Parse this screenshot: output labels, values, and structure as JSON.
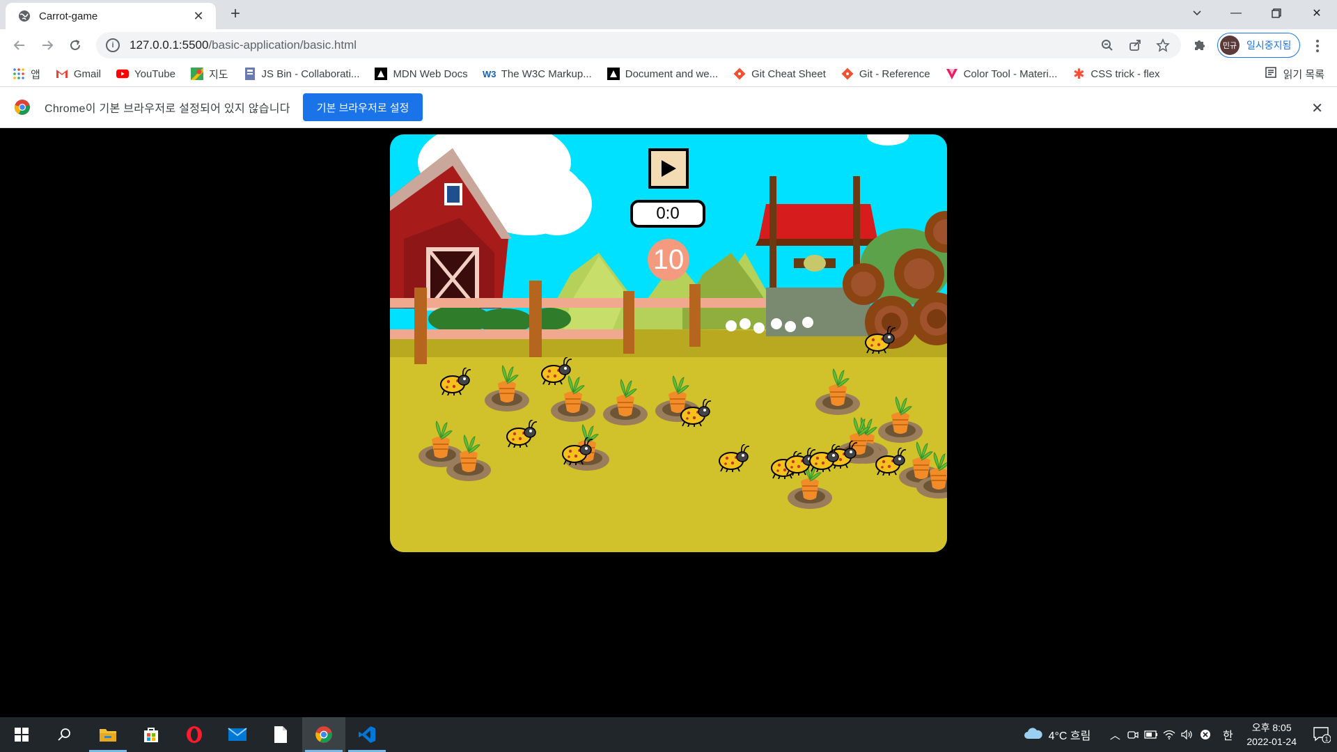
{
  "browser": {
    "tab_title": "Carrot-game",
    "url_host": "127.0.0.1:5500",
    "url_path": "/basic-application/basic.html",
    "profile_initials": "민규",
    "profile_label": "일시중지됨"
  },
  "bookmarks": [
    {
      "label": "앱",
      "icon": "apps-grid-icon"
    },
    {
      "label": "Gmail",
      "icon": "gmail-icon"
    },
    {
      "label": "YouTube",
      "icon": "youtube-icon"
    },
    {
      "label": "지도",
      "icon": "maps-icon"
    },
    {
      "label": "JS Bin - Collaborati...",
      "icon": "jsbin-icon"
    },
    {
      "label": "MDN Web Docs",
      "icon": "mdn-icon"
    },
    {
      "label": "The W3C Markup...",
      "icon": "w3c-icon"
    },
    {
      "label": "Document and we...",
      "icon": "mdn-icon"
    },
    {
      "label": "Git Cheat Sheet",
      "icon": "git-icon"
    },
    {
      "label": "Git - Reference",
      "icon": "git-icon"
    },
    {
      "label": "Color Tool - Materi...",
      "icon": "material-icon"
    },
    {
      "label": "CSS trick - flex",
      "icon": "css-tricks-icon"
    }
  ],
  "reading_list": "읽기 목록",
  "infobar": {
    "message": "Chrome이 기본 브라우저로 설정되어 있지 않습니다",
    "button": "기본 브라우저로 설정"
  },
  "game": {
    "timer": "0:0",
    "score": "10",
    "colors": {
      "sky": "#00e1ff",
      "ground": "#d1c12a",
      "play_bg": "#f3dcb3",
      "score_bg": "#f49b7f"
    },
    "carrot_count": 14,
    "bug_count": 12
  },
  "taskbar": {
    "weather": "4°C 흐림",
    "time": "오후 8:05",
    "date": "2022-01-24",
    "ime": "한",
    "notifications": "1"
  }
}
